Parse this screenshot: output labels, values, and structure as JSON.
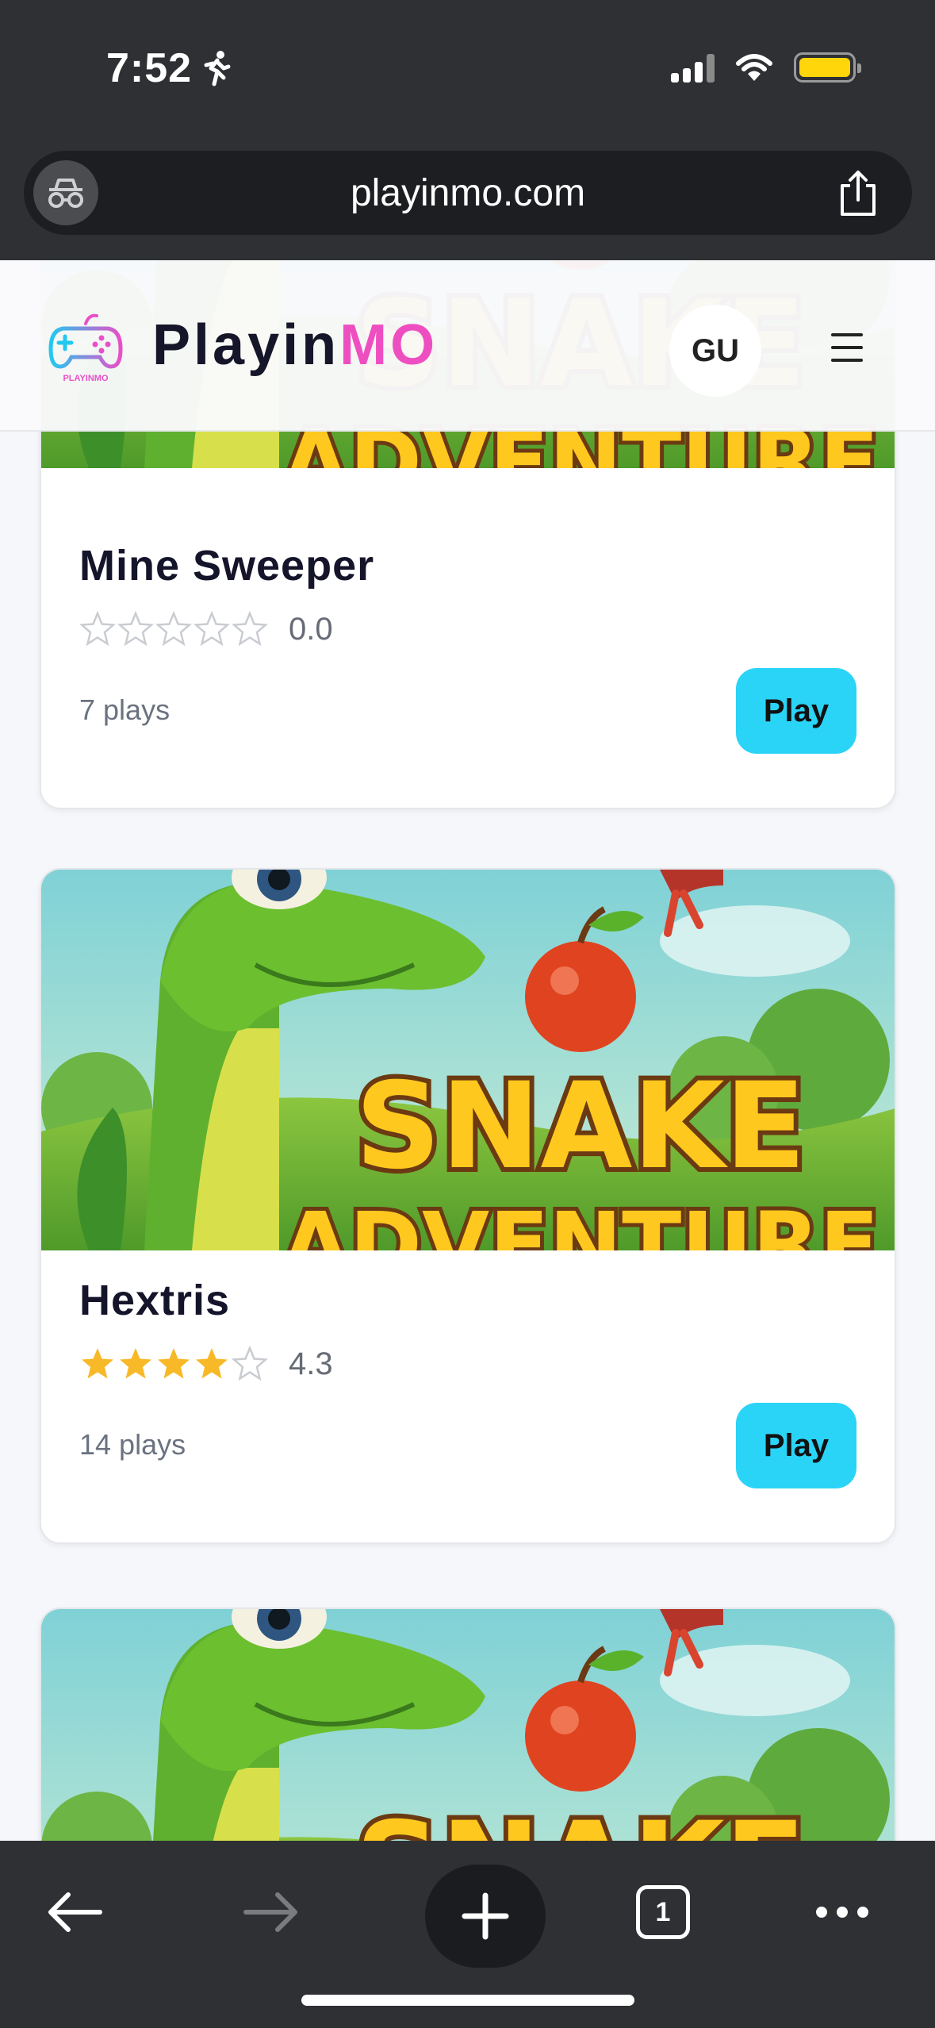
{
  "status_bar": {
    "time": "7:52"
  },
  "browser": {
    "url": "playinmo.com",
    "tab_count": "1"
  },
  "site": {
    "logo_text_main": "Playin",
    "logo_text_accent": "MO",
    "logo_icon_caption": "PLAYINMO",
    "language": "GU"
  },
  "games": [
    {
      "title": "Mine Sweeper",
      "rating": "0.0",
      "rating_value": 0,
      "plays": "7 plays",
      "play_label": "Play"
    },
    {
      "title": "Hextris",
      "rating": "4.3",
      "rating_value": 4.3,
      "plays": "14 plays",
      "play_label": "Play"
    }
  ],
  "thumbnail_text": {
    "line1": "SNAKE",
    "line2": "ADVENTURE"
  },
  "colors": {
    "accent_pink": "#ee4fc0",
    "play_button": "#2ad4f7",
    "star": "#f7b928",
    "browser_chrome": "#2e3034"
  },
  "icons": {
    "status": [
      "runner-icon",
      "signal-icon",
      "wifi-icon",
      "battery-icon"
    ],
    "url_bar": [
      "incognito-icon",
      "share-icon"
    ],
    "toolbar": [
      "back-arrow-icon",
      "forward-arrow-icon",
      "plus-icon",
      "tabs-icon",
      "more-icon"
    ],
    "header": [
      "gamepad-logo-icon",
      "hamburger-menu-icon"
    ]
  }
}
